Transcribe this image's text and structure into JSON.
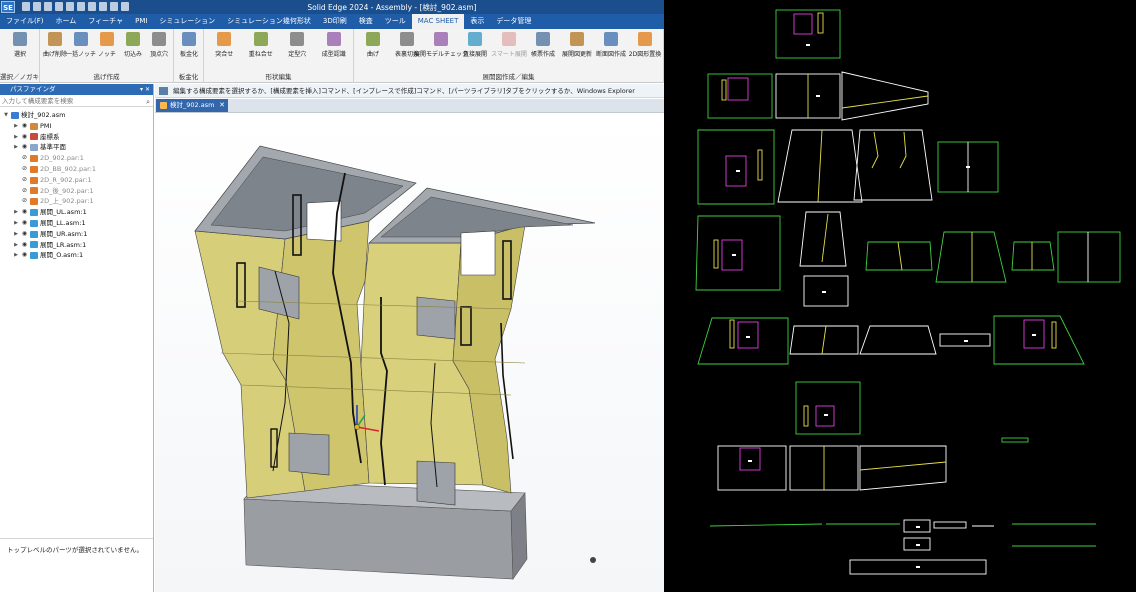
{
  "titlebar": {
    "app_logo": "SE",
    "title": "Solid Edge 2024 - Assembly - [検討_902.asm]"
  },
  "menu": {
    "tabs": [
      "ファイル(F)",
      "ホーム",
      "フィーチャ",
      "PMI",
      "シミュレーション",
      "シミュレーション幾何形状",
      "3D印刷",
      "検査",
      "ツール",
      "MAC SHEET",
      "表示",
      "データ管理"
    ],
    "active_tab": "MAC SHEET"
  },
  "ribbon": {
    "groups": [
      {
        "label": "選択／ノガキ",
        "buttons": [
          "選択"
        ]
      },
      {
        "label": "逃げ作成",
        "buttons": [
          "曲げ削除",
          "一括ノッチ",
          "ノッチ",
          "切込み",
          "頂点穴"
        ]
      },
      {
        "label": "板金化",
        "buttons": [
          "板金化"
        ]
      },
      {
        "label": "形状編集",
        "buttons": [
          "突合せ",
          "重ね合せ",
          "定型穴",
          "成型認識"
        ]
      },
      {
        "label": "展開図作成／編集",
        "buttons": [
          "曲げ",
          "表裏切換",
          "展開モデルチェック",
          "直接展開",
          "スマート展開",
          "帳票作成",
          "展開図更新",
          "断面図作成",
          "2D図形置換"
        ]
      }
    ]
  },
  "command_bar": {
    "text": "編集する構成要素を選択するか、[構成要素を挿入]コマンド、[インプレースで作成]コマンド、[パーツライブラリ]タブをクリックするか、Windows Explorer"
  },
  "pathfinder": {
    "title": "パスファインダ",
    "search_placeholder": "入力して構成要素を検索",
    "items": [
      {
        "label": "検討_902.asm",
        "type": "asm-root"
      },
      {
        "label": "PMI",
        "type": "pmi"
      },
      {
        "label": "座標系",
        "type": "csys"
      },
      {
        "label": "基準平面",
        "type": "plane"
      },
      {
        "label": "2D_902.par:1",
        "type": "par"
      },
      {
        "label": "2D_BB_902.par:1",
        "type": "par"
      },
      {
        "label": "2D_R_902.par:1",
        "type": "par"
      },
      {
        "label": "2D_後_902.par:1",
        "type": "par"
      },
      {
        "label": "2D_上_902.par:1",
        "type": "par"
      },
      {
        "label": "展開_UL.asm:1",
        "type": "asm"
      },
      {
        "label": "展開_LL.asm:1",
        "type": "asm"
      },
      {
        "label": "展開_UR.asm:1",
        "type": "asm"
      },
      {
        "label": "展開_LR.asm:1",
        "type": "asm"
      },
      {
        "label": "展開_O.asm:1",
        "type": "asm"
      }
    ],
    "status": "トップレベルのパーツが選択されていません。"
  },
  "document_tab": {
    "label": "検討_902.asm"
  },
  "colors": {
    "title_blue": "#1b4e8c",
    "menu_blue": "#1f5da8",
    "sheet_metal_yellow": "#d8cf7a",
    "sheet_metal_gray": "#a9aeb4",
    "drawing_green": "#3fd13f",
    "drawing_yellow": "#e9e04a",
    "drawing_magenta": "#e040e0",
    "drawing_white": "#ffffff"
  }
}
